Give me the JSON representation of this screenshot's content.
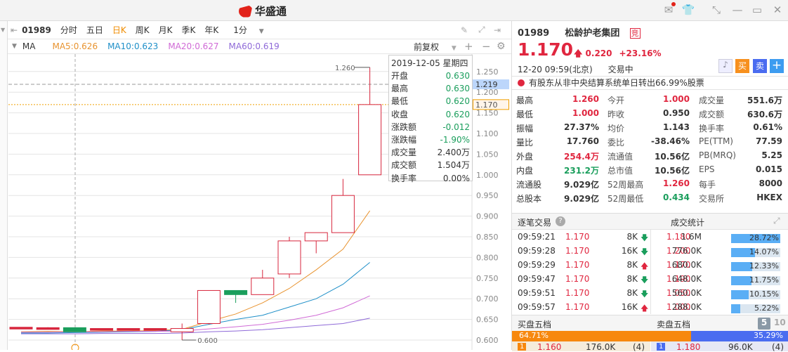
{
  "app": {
    "title": "华盛通"
  },
  "toolbar": {
    "code": "01989",
    "tabs": [
      "分时",
      "五日",
      "日K",
      "周K",
      "月K",
      "季K",
      "年K"
    ],
    "active_tab": "日K",
    "interval": "1分"
  },
  "ma": {
    "label": "MA",
    "ma5": "MA5:0.626",
    "ma10": "MA10:0.623",
    "ma20": "MA20:0.627",
    "ma60": "MA60:0.619",
    "adjust": "前复权",
    "colors": {
      "ma5": "#e8932f",
      "ma10": "#1e8fc8",
      "ma20": "#d06ad6",
      "ma60": "#8f6ad8"
    }
  },
  "tooltip": {
    "date": "2019-12-05 星期四",
    "rows": [
      [
        "开盘",
        "0.630"
      ],
      [
        "最高",
        "0.630"
      ],
      [
        "最低",
        "0.620"
      ],
      [
        "收盘",
        "0.620"
      ],
      [
        "涨跌额",
        "-0.012"
      ],
      [
        "涨跌幅",
        "-1.90%"
      ],
      [
        "成交量",
        "2.400万"
      ],
      [
        "成交额",
        "1.504万"
      ],
      [
        "换手率",
        "0.00%"
      ]
    ]
  },
  "chart_data": {
    "type": "candlestick",
    "ylim": [
      0.59,
      1.27
    ],
    "yticks": [
      "1.250",
      "1.200",
      "1.150",
      "1.100",
      "1.050",
      "1.000",
      "0.950",
      "0.900",
      "0.850",
      "0.800",
      "0.750",
      "0.700",
      "0.650",
      "0.600"
    ],
    "crosshair_price": "1.219",
    "last_price": "1.170",
    "high_label": "1.260",
    "low_label": "0.600",
    "candles": [
      [
        0.63,
        0.631,
        0.629,
        0.631
      ],
      [
        0.629,
        0.631,
        0.628,
        0.63
      ],
      [
        0.63,
        0.63,
        0.62,
        0.62
      ],
      [
        0.626,
        0.628,
        0.625,
        0.628
      ],
      [
        0.626,
        0.628,
        0.625,
        0.628
      ],
      [
        0.626,
        0.628,
        0.625,
        0.628
      ],
      [
        0.62,
        0.64,
        0.6,
        0.628
      ],
      [
        0.64,
        0.72,
        0.638,
        0.72
      ],
      [
        0.72,
        0.72,
        0.69,
        0.71
      ],
      [
        0.71,
        0.77,
        0.71,
        0.75
      ],
      [
        0.76,
        0.85,
        0.75,
        0.84
      ],
      [
        0.84,
        0.86,
        0.81,
        0.86
      ],
      [
        0.86,
        0.99,
        0.86,
        0.95
      ],
      [
        1.0,
        1.26,
        1.0,
        1.17
      ]
    ],
    "series": [
      {
        "name": "MA5",
        "values": [
          0.62,
          0.621,
          0.62,
          0.622,
          0.622,
          0.623,
          0.626,
          0.645,
          0.663,
          0.69,
          0.725,
          0.77,
          0.82,
          0.913
        ]
      },
      {
        "name": "MA10",
        "values": [
          0.617,
          0.617,
          0.618,
          0.619,
          0.62,
          0.621,
          0.625,
          0.638,
          0.65,
          0.66,
          0.68,
          0.7,
          0.735,
          0.788
        ]
      },
      {
        "name": "MA20",
        "values": [
          0.619,
          0.619,
          0.62,
          0.62,
          0.621,
          0.621,
          0.622,
          0.627,
          0.632,
          0.638,
          0.648,
          0.66,
          0.678,
          0.707
        ]
      },
      {
        "name": "MA60",
        "values": [
          0.615,
          0.615,
          0.615,
          0.616,
          0.616,
          0.616,
          0.617,
          0.62,
          0.622,
          0.625,
          0.63,
          0.635,
          0.64,
          0.653
        ]
      }
    ]
  },
  "quote": {
    "code": "01989",
    "name": "松龄护老集团",
    "tag": "竞",
    "price": "1.170",
    "change": "0.220",
    "pct": "+23.16%",
    "time": "12-20  09:59(北京)",
    "status": "交易中",
    "buy": "买",
    "sell": "卖",
    "add": "+",
    "notice": "有股东从非中央结算系统单日转出66.99%股票"
  },
  "stats": [
    [
      [
        "最高",
        "1.260",
        "red"
      ],
      [
        "今开",
        "1.000",
        "red"
      ],
      [
        "成交量",
        "551.6万",
        ""
      ]
    ],
    [
      [
        "最低",
        "1.000",
        "red"
      ],
      [
        "昨收",
        "0.950",
        ""
      ],
      [
        "成交额",
        "630.6万",
        ""
      ]
    ],
    [
      [
        "振幅",
        "27.37%",
        ""
      ],
      [
        "均价",
        "1.143",
        ""
      ],
      [
        "换手率",
        "0.61%",
        ""
      ]
    ],
    [
      [
        "量比",
        "17.760",
        ""
      ],
      [
        "委比",
        "-38.46%",
        ""
      ],
      [
        "PE(TTM)",
        "77.59",
        ""
      ]
    ],
    [
      [
        "外盘",
        "254.4万",
        "red"
      ],
      [
        "流通值",
        "10.56亿",
        ""
      ],
      [
        "PB(MRQ)",
        "5.25",
        ""
      ]
    ],
    [
      [
        "内盘",
        "231.2万",
        "green"
      ],
      [
        "总市值",
        "10.56亿",
        ""
      ],
      [
        "EPS",
        "0.015",
        ""
      ]
    ],
    [
      [
        "流通股",
        "9.029亿",
        ""
      ],
      [
        "52周最高",
        "1.260",
        "red"
      ],
      [
        "每手",
        "8000",
        ""
      ]
    ],
    [
      [
        "总股本",
        "9.029亿",
        ""
      ],
      [
        "52周最低",
        "0.434",
        "green"
      ],
      [
        "交易所",
        "HKEX",
        ""
      ]
    ]
  ],
  "trades": {
    "title": "逐笔交易",
    "stat_title": "成交统计",
    "rows": [
      [
        "09:59:21",
        "1.170",
        "8K",
        "down"
      ],
      [
        "09:59:28",
        "1.170",
        "16K",
        "down"
      ],
      [
        "09:59:29",
        "1.170",
        "8K",
        "up"
      ],
      [
        "09:59:47",
        "1.170",
        "8K",
        "down"
      ],
      [
        "09:59:51",
        "1.170",
        "8K",
        "down"
      ],
      [
        "09:59:57",
        "1.170",
        "16K",
        "up"
      ]
    ],
    "stats": [
      [
        "1.180",
        "1.6M",
        "28.72%",
        28.72
      ],
      [
        "1.200",
        "776.0K",
        "14.07%",
        14.07
      ],
      [
        "1.170",
        "680.0K",
        "12.33%",
        12.33
      ],
      [
        "1.190",
        "648.0K",
        "11.75%",
        11.75
      ],
      [
        "1.050",
        "560.0K",
        "10.15%",
        10.15
      ],
      [
        "1.000",
        "288.0K",
        "5.22%",
        5.22
      ]
    ]
  },
  "depth": {
    "buy_title": "买盘五档",
    "sell_title": "卖盘五档",
    "levels5": "5",
    "levels10": "10",
    "buy_pct": "64.71%",
    "sell_pct": "35.29%",
    "buy_ratio": 64.71,
    "buy1": [
      "1",
      "1.160",
      "176.0K",
      "(4)"
    ],
    "sell1": [
      "1",
      "1.180",
      "96.0K",
      "(4)"
    ]
  }
}
